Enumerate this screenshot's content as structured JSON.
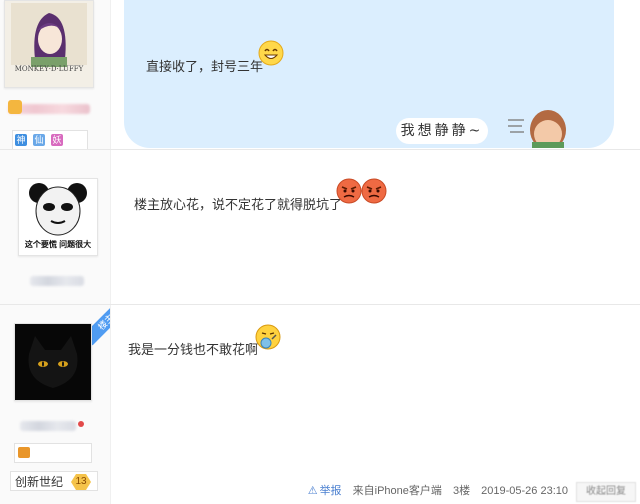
{
  "posts": [
    {
      "text": "直接收了，封号三年",
      "sticker_text": "我想静静~",
      "avatar_caption": "MONKEY·D·LUFFY",
      "badges": [
        "神",
        "仙",
        "妖"
      ]
    },
    {
      "text": "楼主放心花，说不定花了就得脱坑了",
      "avatar_caption": "这个要慌 问题很大"
    },
    {
      "text": "我是一分钱也不敢花啊",
      "ribbon": "楼主",
      "level_name": "创新世纪",
      "level_num": "13",
      "footer": {
        "report": "举报",
        "source": "来自iPhone客户端",
        "floor": "3楼",
        "time": "2019-05-26 23:10",
        "reply": "收起回复"
      }
    }
  ],
  "colors": {
    "bubble": "#dbeefe",
    "accent": "#4f9cf2",
    "level": "#f5c34a"
  }
}
